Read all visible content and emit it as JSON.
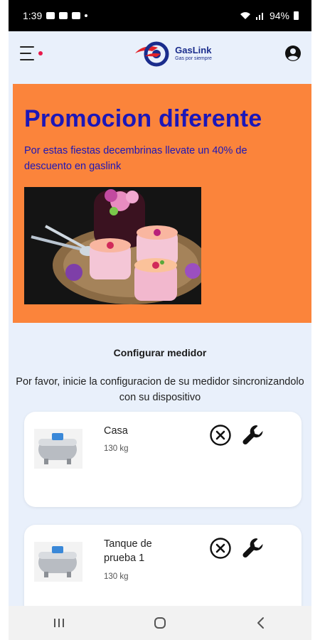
{
  "status_bar": {
    "time": "1:39",
    "battery": "94%"
  },
  "app_bar": {
    "logo_name": "GasLink",
    "logo_tagline": "Gas por siempre",
    "menu_icon": "hamburger-menu-icon",
    "account_icon": "account-circle-icon"
  },
  "promo": {
    "title": "Promocion diferente",
    "text": "Por estas fiestas decembrinas llevate un 40% de descuento en gaslink",
    "image_icon": "dessert-photo",
    "background_color": "#fb843b",
    "text_color": "#1c17b8"
  },
  "config": {
    "title": "Configurar medidor",
    "text": "Por favor, inicie la configuracion de su medidor sincronizandolo con su dispositivo"
  },
  "meters": [
    {
      "name": "Casa",
      "weight": "130 kg",
      "icon": "gas-tank-icon"
    },
    {
      "name": "Tanque de prueba 1",
      "weight": "130 kg",
      "icon": "gas-tank-icon"
    }
  ],
  "nav": {
    "recents_icon": "recents-icon",
    "home_icon": "home-icon",
    "back_icon": "back-icon"
  }
}
